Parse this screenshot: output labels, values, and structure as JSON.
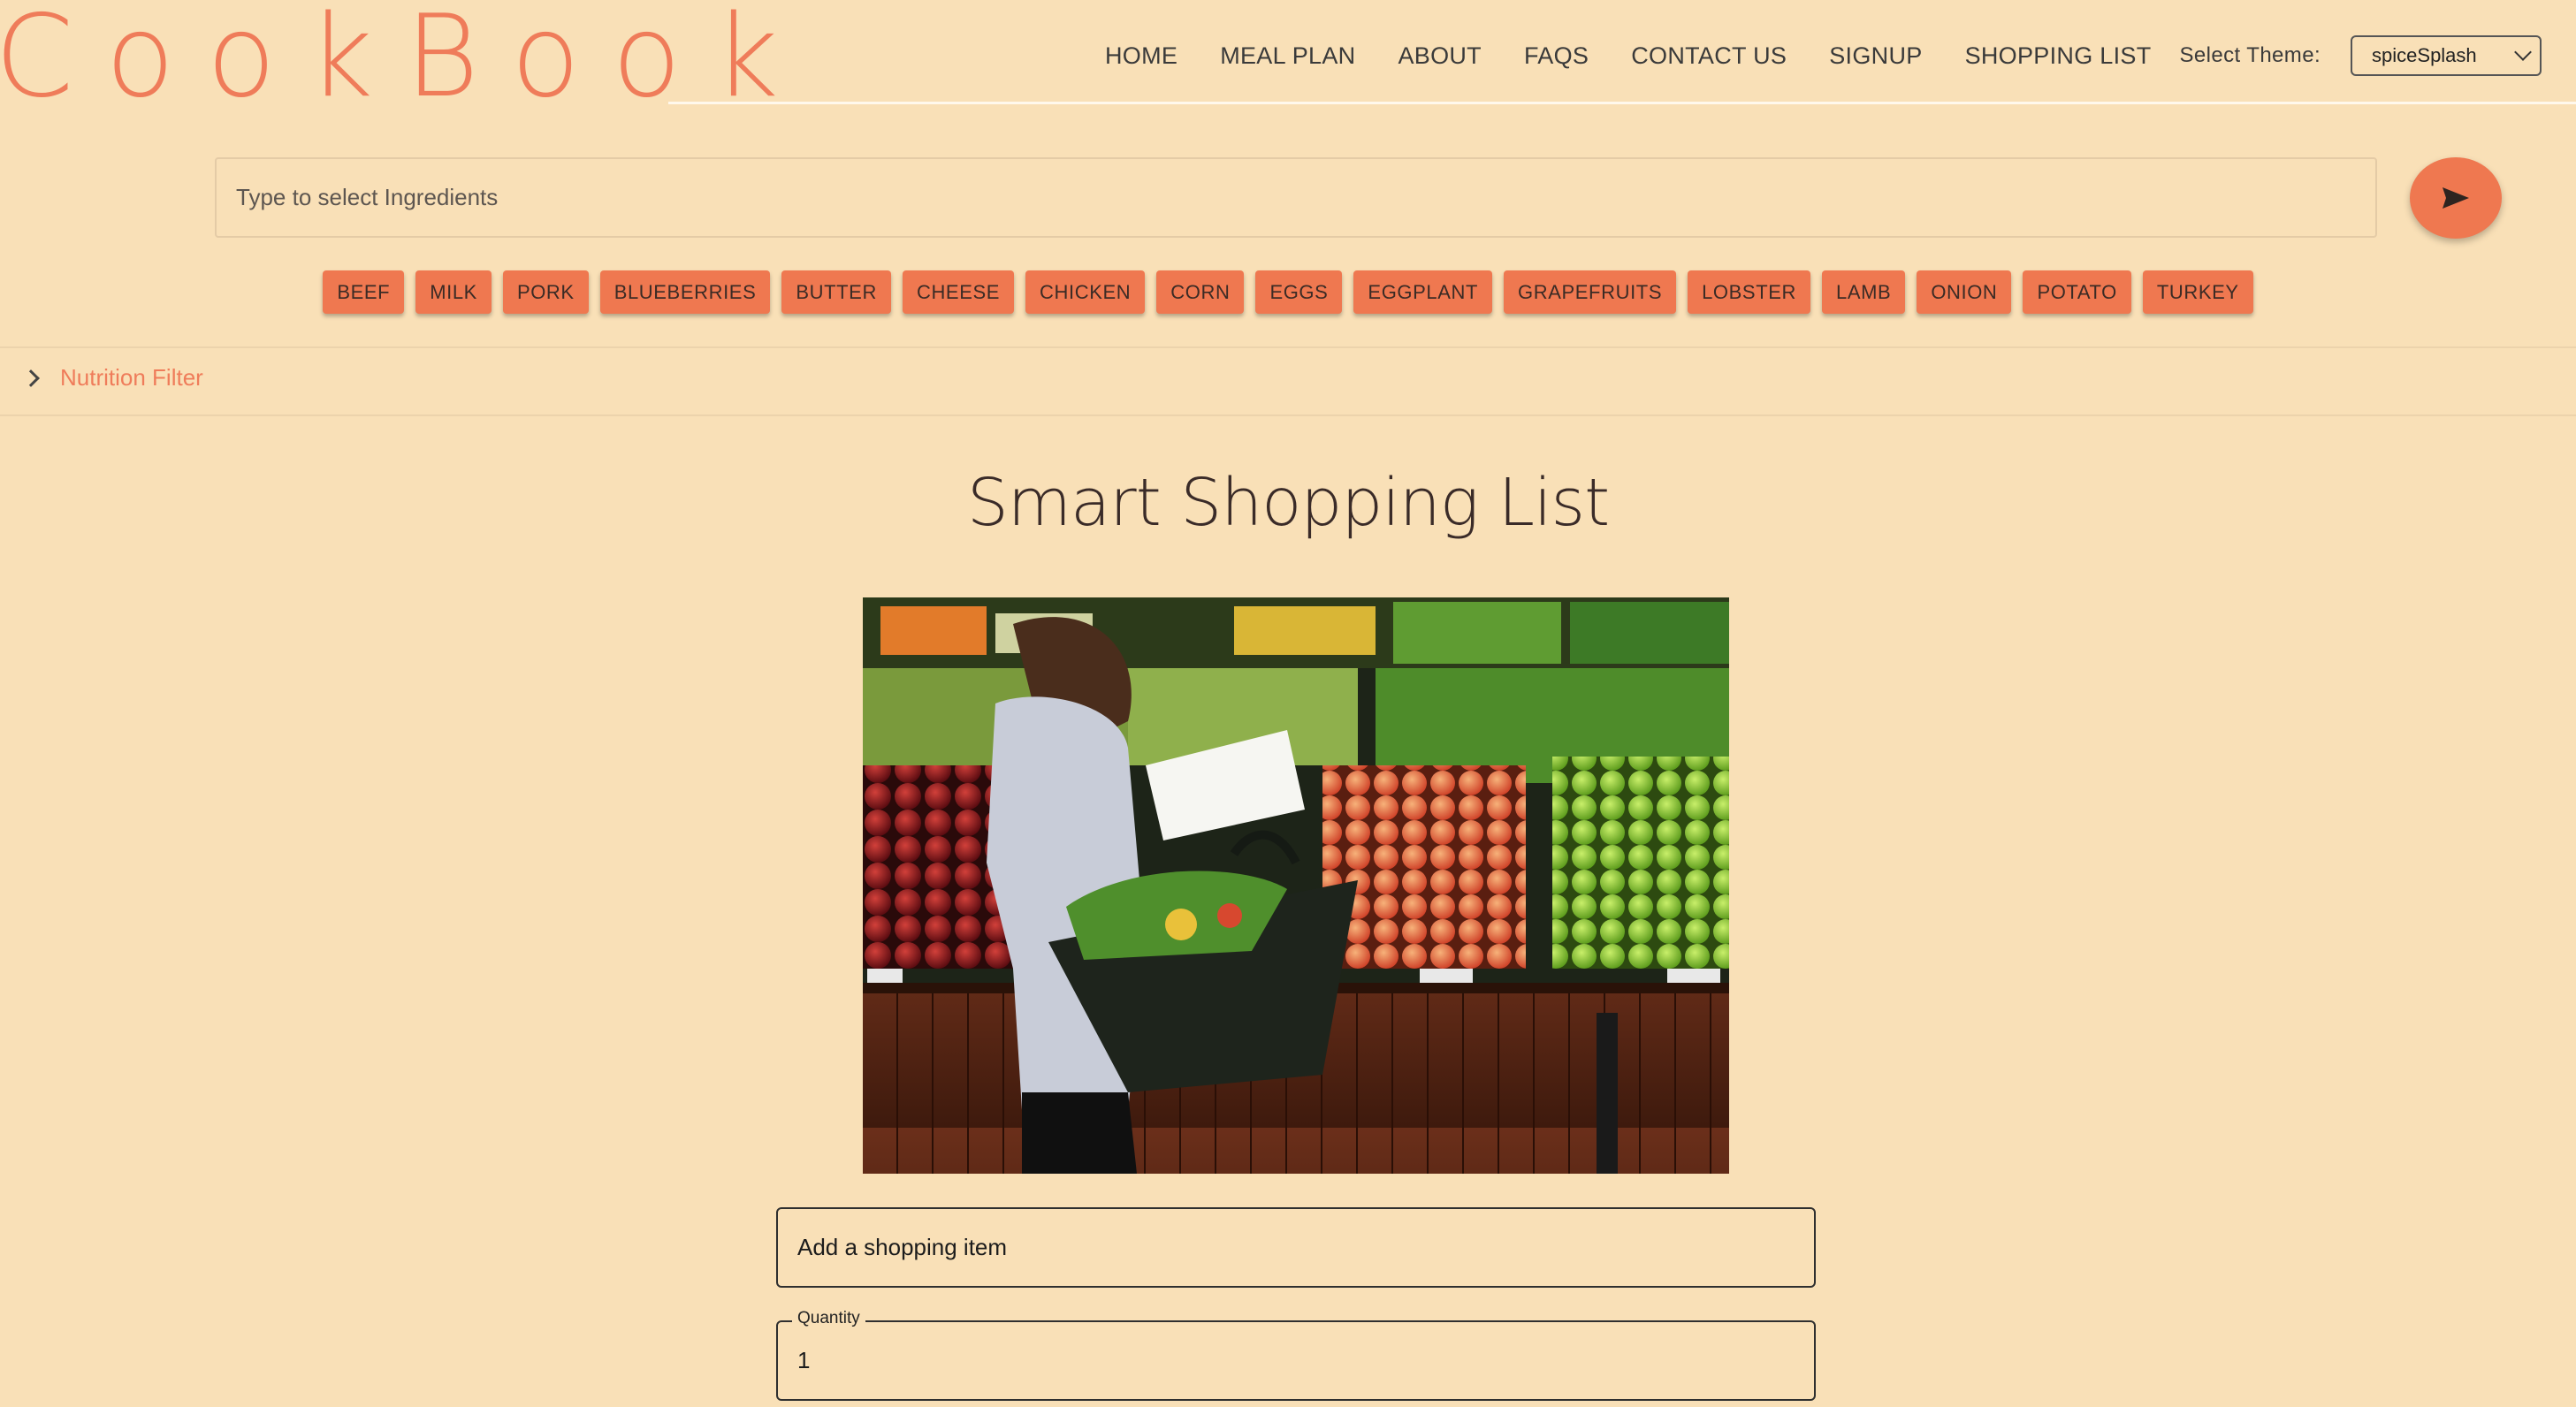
{
  "app": {
    "brand": "CookBook"
  },
  "nav": {
    "items": [
      "HOME",
      "MEAL PLAN",
      "ABOUT",
      "FAQS",
      "CONTACT US",
      "SIGNUP",
      "SHOPPING LIST"
    ],
    "theme_label": "Select Theme:",
    "theme_value": "spiceSplash"
  },
  "search": {
    "placeholder": "Type to select Ingredients",
    "send_icon": "send-icon"
  },
  "ingredients": [
    "BEEF",
    "MILK",
    "PORK",
    "BLUEBERRIES",
    "BUTTER",
    "CHEESE",
    "CHICKEN",
    "CORN",
    "EGGS",
    "EGGPLANT",
    "GRAPEFRUITS",
    "LOBSTER",
    "LAMB",
    "ONION",
    "POTATO",
    "TURKEY"
  ],
  "nutrition_filter": {
    "label": "Nutrition Filter",
    "icon": "chevron-right-icon"
  },
  "main": {
    "title": "Smart Shopping List",
    "item_placeholder": "Add a shopping item",
    "quantity_label": "Quantity",
    "quantity_value": "1"
  },
  "colors": {
    "background": "#f9e0b7",
    "accent": "#ef7850",
    "brand_text": "#ef7c5a"
  }
}
